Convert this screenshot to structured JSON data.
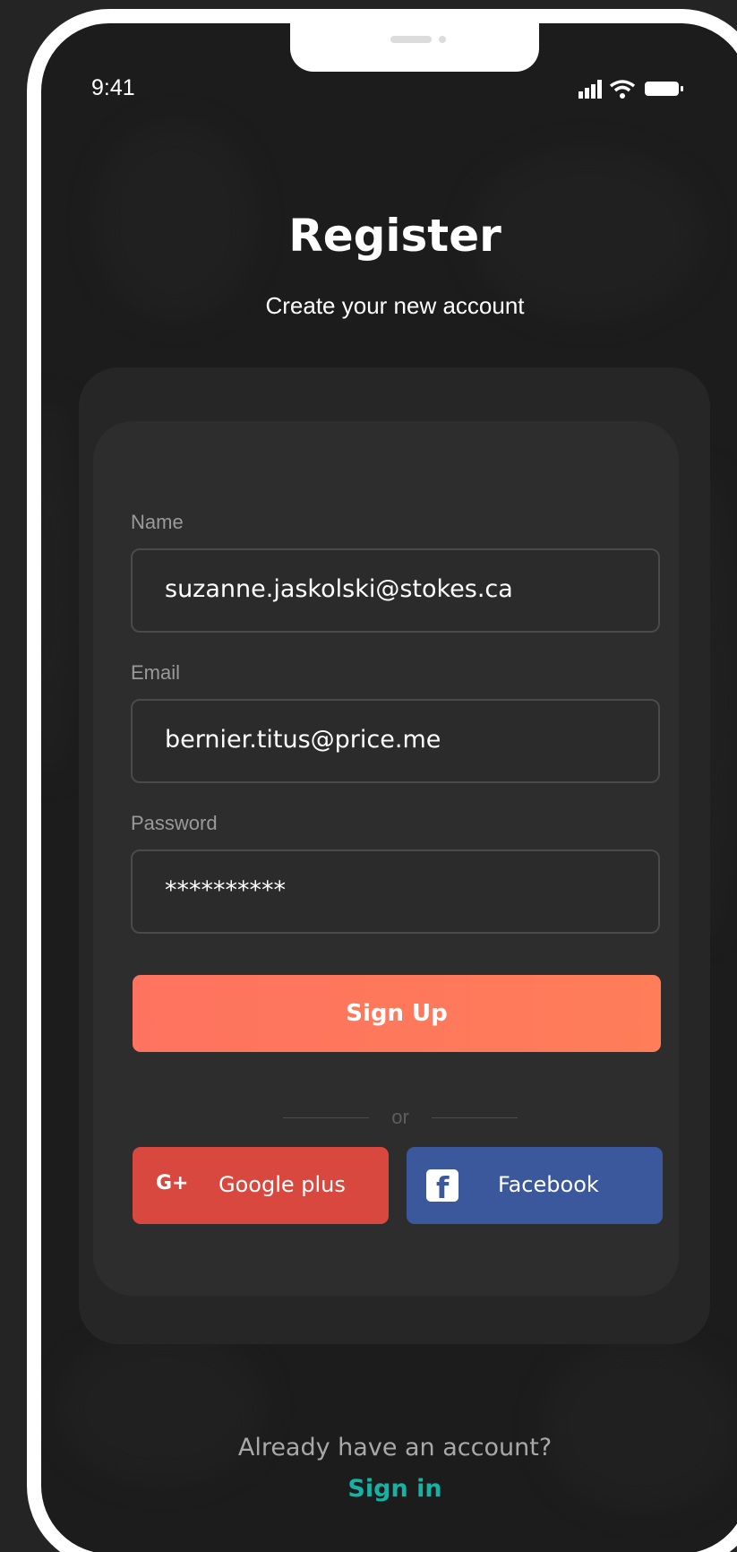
{
  "status_bar": {
    "time": "9:41",
    "icons": [
      "signal-icon",
      "wifi-icon",
      "battery-icon"
    ]
  },
  "header": {
    "title": "Register",
    "subtitle": "Create your new account"
  },
  "form": {
    "name": {
      "label": "Name",
      "value": "suzanne.jaskolski@stokes.ca"
    },
    "email": {
      "label": "Email",
      "value": "bernier.titus@price.me"
    },
    "password": {
      "label": "Password",
      "value": "**********"
    },
    "signup_label": "Sign Up",
    "divider_text": "or"
  },
  "social": {
    "google_glyph": "G+",
    "google_label": "Google plus",
    "facebook_glyph": "f",
    "facebook_label": "Facebook"
  },
  "footer": {
    "prompt": "Already have an account?",
    "signin_label": "Sign in"
  },
  "colors": {
    "accent": "#FE735F",
    "google": "#D9483E",
    "facebook": "#3A589B",
    "link": "#14B3A4"
  }
}
